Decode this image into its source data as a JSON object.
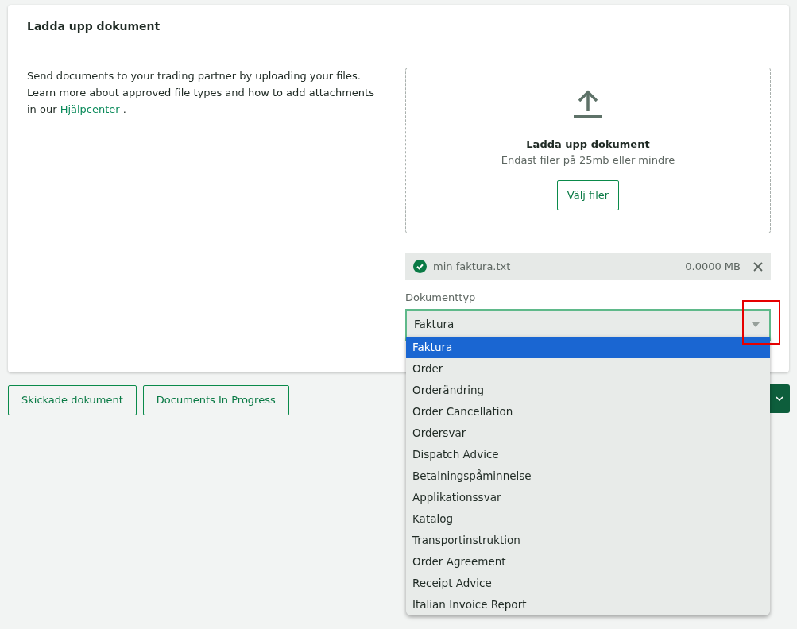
{
  "card": {
    "title": "Ladda upp dokument",
    "intro": "Send documents to your trading partner by uploading your files. Learn more about approved file types and how to add attachments in our",
    "help_link": "Hjälpcenter",
    "intro_end": "."
  },
  "dropzone": {
    "title": "Ladda upp dokument",
    "hint": "Endast filer på 25mb eller mindre",
    "button": "Välj filer"
  },
  "file": {
    "name": "min faktura.txt",
    "size": "0.0000 MB",
    "uploaded": true
  },
  "document_type": {
    "label": "Dokumenttyp",
    "value": "Faktura",
    "expanded": true,
    "options": [
      {
        "label": "Faktura",
        "selected": true
      },
      {
        "label": "Order",
        "selected": false
      },
      {
        "label": "Orderändring",
        "selected": false
      },
      {
        "label": "Order Cancellation",
        "selected": false
      },
      {
        "label": "Ordersvar",
        "selected": false
      },
      {
        "label": "Dispatch Advice",
        "selected": false
      },
      {
        "label": "Betalningspåminnelse",
        "selected": false
      },
      {
        "label": "Applikationssvar",
        "selected": false
      },
      {
        "label": "Katalog",
        "selected": false
      },
      {
        "label": "Transportinstruktion",
        "selected": false
      },
      {
        "label": "Order Agreement",
        "selected": false
      },
      {
        "label": "Receipt Advice",
        "selected": false
      },
      {
        "label": "Italian Invoice Report",
        "selected": false
      }
    ]
  },
  "buttons": [
    {
      "label": "Skickade dokument"
    },
    {
      "label": "Documents In Progress"
    }
  ]
}
